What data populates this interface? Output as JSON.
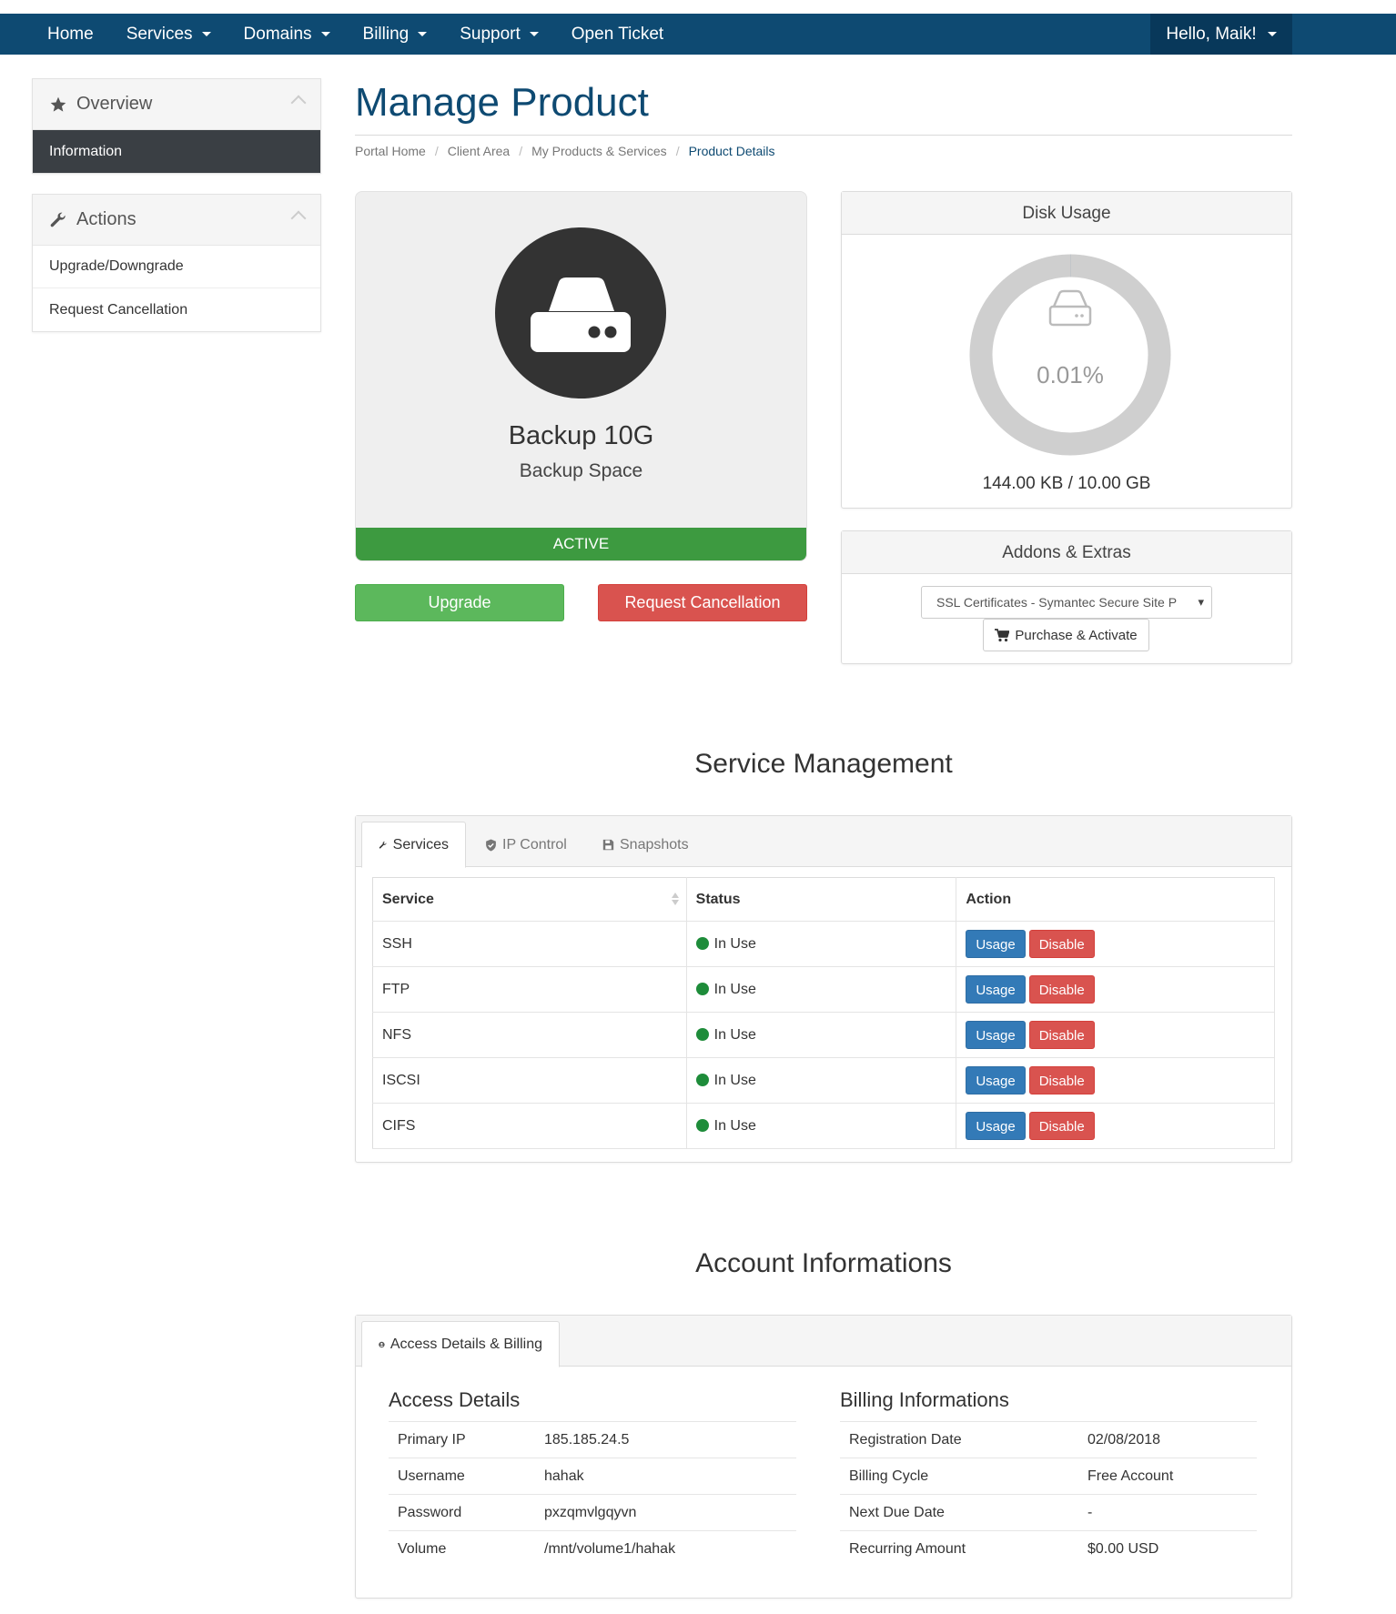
{
  "nav": {
    "items": [
      {
        "label": "Home",
        "dropdown": false
      },
      {
        "label": "Services",
        "dropdown": true
      },
      {
        "label": "Domains",
        "dropdown": true
      },
      {
        "label": "Billing",
        "dropdown": true
      },
      {
        "label": "Support",
        "dropdown": true
      },
      {
        "label": "Open Ticket",
        "dropdown": false
      }
    ],
    "user": "Hello, Maik!"
  },
  "sidebar": {
    "overview": {
      "title": "Overview",
      "icon": "star-icon",
      "items": [
        "Information"
      ]
    },
    "actions": {
      "title": "Actions",
      "icon": "wrench-icon",
      "items": [
        "Upgrade/Downgrade",
        "Request Cancellation"
      ]
    }
  },
  "page": {
    "title": "Manage Product",
    "breadcrumb": [
      "Portal Home",
      "Client Area",
      "My Products & Services",
      "Product Details"
    ]
  },
  "product": {
    "name": "Backup 10G",
    "group": "Backup Space",
    "status": "ACTIVE",
    "upgrade_label": "Upgrade",
    "cancel_label": "Request Cancellation",
    "icon": "hdd-icon"
  },
  "disk": {
    "title": "Disk Usage",
    "percent_label": "0.01%",
    "percent_value": 0.01,
    "usage": "144.00 KB / 10.00 GB"
  },
  "addons": {
    "title": "Addons & Extras",
    "selected": "SSL Certificates - Symantec Secure Site P",
    "button": "Purchase & Activate"
  },
  "service_management": {
    "title": "Service Management",
    "tabs": [
      {
        "label": "Services",
        "icon": "wrench-icon"
      },
      {
        "label": "IP Control",
        "icon": "shield-icon"
      },
      {
        "label": "Snapshots",
        "icon": "save-icon"
      }
    ],
    "columns": [
      "Service",
      "Status",
      "Action"
    ],
    "rows": [
      {
        "service": "SSH",
        "status": "In Use"
      },
      {
        "service": "FTP",
        "status": "In Use"
      },
      {
        "service": "NFS",
        "status": "In Use"
      },
      {
        "service": "ISCSI",
        "status": "In Use"
      },
      {
        "service": "CIFS",
        "status": "In Use"
      }
    ],
    "usage_label": "Usage",
    "disable_label": "Disable",
    "status_color": "#1e8c3a"
  },
  "account": {
    "title": "Account Informations",
    "tab": "Access Details & Billing",
    "access": {
      "title": "Access Details",
      "rows": [
        {
          "k": "Primary IP",
          "v": "185.185.24.5"
        },
        {
          "k": "Username",
          "v": "hahak"
        },
        {
          "k": "Password",
          "v": "pxzqmvlgqyvn"
        },
        {
          "k": "Volume",
          "v": "/mnt/volume1/hahak"
        }
      ]
    },
    "billing": {
      "title": "Billing Informations",
      "rows": [
        {
          "k": "Registration Date",
          "v": "02/08/2018"
        },
        {
          "k": "Billing Cycle",
          "v": "Free Account"
        },
        {
          "k": "Next Due Date",
          "v": "-"
        },
        {
          "k": "Recurring Amount",
          "v": "$0.00 USD"
        }
      ]
    }
  },
  "colors": {
    "nav": "#0e4a72",
    "active_green": "#3d9a40",
    "btn_green": "#5cb85c",
    "btn_red": "#d9534f",
    "btn_blue": "#337ab7"
  }
}
